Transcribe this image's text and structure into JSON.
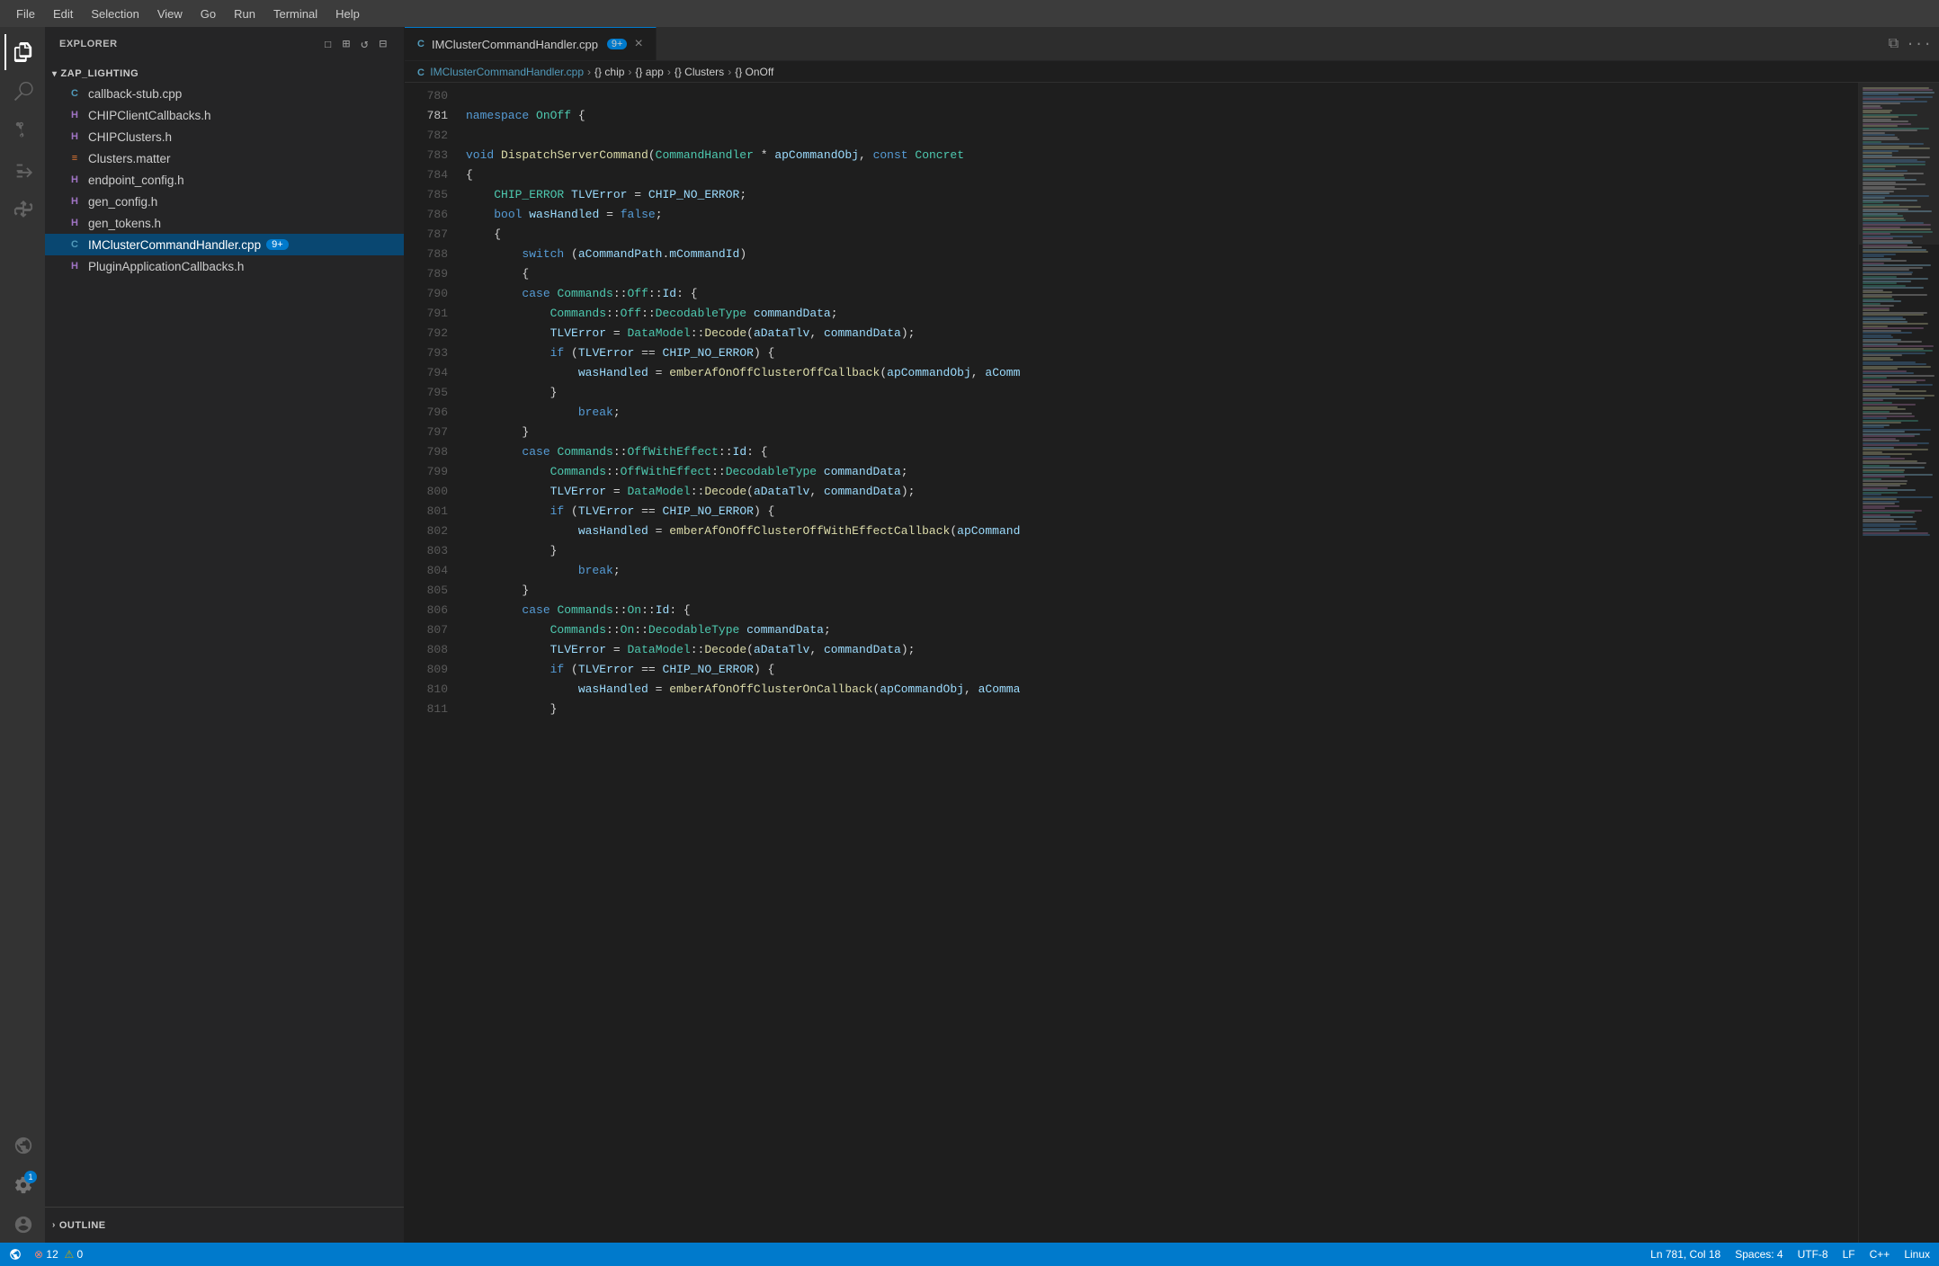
{
  "menu": {
    "items": [
      "File",
      "Edit",
      "Selection",
      "View",
      "Go",
      "Run",
      "Terminal",
      "Help"
    ]
  },
  "activity_bar": {
    "icons": [
      {
        "name": "explorer-icon",
        "symbol": "⎘",
        "active": true
      },
      {
        "name": "search-icon",
        "symbol": "🔍",
        "active": false
      },
      {
        "name": "source-control-icon",
        "symbol": "⎇",
        "active": false
      },
      {
        "name": "run-debug-icon",
        "symbol": "▷",
        "active": false
      },
      {
        "name": "extensions-icon",
        "symbol": "⊞",
        "active": false
      },
      {
        "name": "remote-icon",
        "symbol": "⊟",
        "active": false
      },
      {
        "name": "timeline-icon",
        "symbol": "⊙",
        "active": false
      }
    ],
    "bottom_icons": [
      {
        "name": "account-icon",
        "symbol": "👤"
      },
      {
        "name": "settings-icon",
        "symbol": "⚙",
        "badge": "1"
      }
    ]
  },
  "sidebar": {
    "title": "Explorer",
    "project_name": "ZAP_LIGHTING",
    "files": [
      {
        "name": "callback-stub.cpp",
        "type": "cpp"
      },
      {
        "name": "CHIPClientCallbacks.h",
        "type": "h"
      },
      {
        "name": "CHIPClusters.h",
        "type": "h"
      },
      {
        "name": "Clusters.matter",
        "type": "matter"
      },
      {
        "name": "endpoint_config.h",
        "type": "h"
      },
      {
        "name": "gen_config.h",
        "type": "h"
      },
      {
        "name": "gen_tokens.h",
        "type": "h"
      },
      {
        "name": "IMClusterCommandHandler.cpp",
        "type": "cpp",
        "active": true,
        "badge": "9+"
      },
      {
        "name": "PluginApplicationCallbacks.h",
        "type": "h"
      }
    ],
    "outline_label": "Outline"
  },
  "editor": {
    "tab_label": "IMClusterCommandHandler.cpp",
    "tab_badge": "9+",
    "breadcrumb": [
      "IMClusterCommandHandler.cpp",
      "chip",
      "app",
      "Clusters",
      "OnOff"
    ],
    "lines": [
      {
        "num": 780,
        "content": ""
      },
      {
        "num": 781,
        "content": "namespace OnOff {"
      },
      {
        "num": 782,
        "content": ""
      },
      {
        "num": 783,
        "content": "void DispatchServerCommand(CommandHandler * apCommandObj, const Concret"
      },
      {
        "num": 784,
        "content": "{"
      },
      {
        "num": 785,
        "content": "    CHIP_ERROR TLVError = CHIP_NO_ERROR;"
      },
      {
        "num": 786,
        "content": "    bool wasHandled = false;"
      },
      {
        "num": 787,
        "content": "    {"
      },
      {
        "num": 788,
        "content": "        switch (aCommandPath.mCommandId)"
      },
      {
        "num": 789,
        "content": "        {"
      },
      {
        "num": 790,
        "content": "        case Commands::Off::Id: {"
      },
      {
        "num": 791,
        "content": "            Commands::Off::DecodableType commandData;"
      },
      {
        "num": 792,
        "content": "            TLVError = DataModel::Decode(aDataTlv, commandData);"
      },
      {
        "num": 793,
        "content": "            if (TLVError == CHIP_NO_ERROR) {"
      },
      {
        "num": 794,
        "content": "                wasHandled = emberAfOnOffClusterOffCallback(apCommandObj, aComm"
      },
      {
        "num": 795,
        "content": "            }"
      },
      {
        "num": 796,
        "content": "                break;"
      },
      {
        "num": 797,
        "content": "        }"
      },
      {
        "num": 798,
        "content": "        case Commands::OffWithEffect::Id: {"
      },
      {
        "num": 799,
        "content": "            Commands::OffWithEffect::DecodableType commandData;"
      },
      {
        "num": 800,
        "content": "            TLVError = DataModel::Decode(aDataTlv, commandData);"
      },
      {
        "num": 801,
        "content": "            if (TLVError == CHIP_NO_ERROR) {"
      },
      {
        "num": 802,
        "content": "                wasHandled = emberAfOnOffClusterOffWithEffectCallback(apCommand"
      },
      {
        "num": 803,
        "content": "            }"
      },
      {
        "num": 804,
        "content": "                break;"
      },
      {
        "num": 805,
        "content": "        }"
      },
      {
        "num": 806,
        "content": "        case Commands::On::Id: {"
      },
      {
        "num": 807,
        "content": "            Commands::On::DecodableType commandData;"
      },
      {
        "num": 808,
        "content": "            TLVError = DataModel::Decode(aDataTlv, commandData);"
      },
      {
        "num": 809,
        "content": "            if (TLVError == CHIP_NO_ERROR) {"
      },
      {
        "num": 810,
        "content": "                wasHandled = emberAfOnOffClusterOnCallback(apCommandObj, aComma"
      },
      {
        "num": 811,
        "content": "            }"
      }
    ]
  },
  "status_bar": {
    "errors": "12",
    "warnings": "0",
    "position": "Ln 781, Col 18",
    "spaces": "Spaces: 4",
    "encoding": "UTF-8",
    "line_ending": "LF",
    "language": "C++",
    "os": "Linux"
  }
}
